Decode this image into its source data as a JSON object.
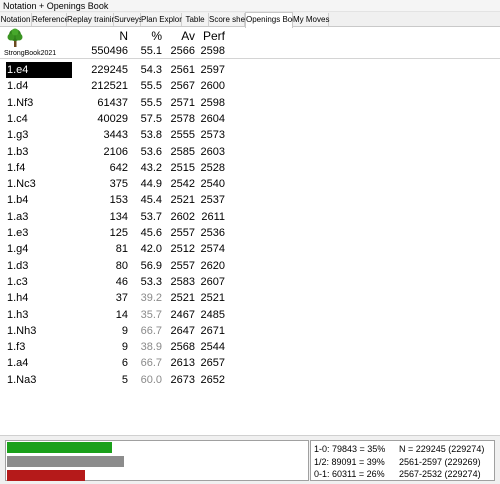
{
  "window": {
    "title": "Notation + Openings Book"
  },
  "tabs": [
    {
      "label": "Notation",
      "active": false
    },
    {
      "label": "Reference",
      "active": false
    },
    {
      "label": "Replay training",
      "active": false
    },
    {
      "label": "Surveys",
      "active": false
    },
    {
      "label": "Plan Explorer",
      "active": false
    },
    {
      "label": "Table",
      "active": false
    },
    {
      "label": "Score sheet",
      "active": false
    },
    {
      "label": "Openings Book",
      "active": true
    },
    {
      "label": "My Moves",
      "active": false
    }
  ],
  "book": {
    "name": "StrongBook2021",
    "icon": "tree-icon"
  },
  "columns": {
    "move": "",
    "n": "N",
    "pct": "%",
    "av": "Av",
    "perf": "Perf"
  },
  "totals": {
    "n": "550496",
    "pct": "55.1",
    "av": "2566",
    "perf": "2598"
  },
  "moves": [
    {
      "move": "1.e4",
      "n": "229245",
      "pct": "54.3",
      "av": "2561",
      "perf": "2597",
      "selected": true,
      "dim": false
    },
    {
      "move": "1.d4",
      "n": "212521",
      "pct": "55.5",
      "av": "2567",
      "perf": "2600",
      "selected": false,
      "dim": false
    },
    {
      "move": "1.Nf3",
      "n": "61437",
      "pct": "55.5",
      "av": "2571",
      "perf": "2598",
      "selected": false,
      "dim": false
    },
    {
      "move": "1.c4",
      "n": "40029",
      "pct": "57.5",
      "av": "2578",
      "perf": "2604",
      "selected": false,
      "dim": false
    },
    {
      "move": "1.g3",
      "n": "3443",
      "pct": "53.8",
      "av": "2555",
      "perf": "2573",
      "selected": false,
      "dim": false
    },
    {
      "move": "1.b3",
      "n": "2106",
      "pct": "53.6",
      "av": "2585",
      "perf": "2603",
      "selected": false,
      "dim": false
    },
    {
      "move": "1.f4",
      "n": "642",
      "pct": "43.2",
      "av": "2515",
      "perf": "2528",
      "selected": false,
      "dim": false
    },
    {
      "move": "1.Nc3",
      "n": "375",
      "pct": "44.9",
      "av": "2542",
      "perf": "2540",
      "selected": false,
      "dim": false
    },
    {
      "move": "1.b4",
      "n": "153",
      "pct": "45.4",
      "av": "2521",
      "perf": "2537",
      "selected": false,
      "dim": false
    },
    {
      "move": "1.a3",
      "n": "134",
      "pct": "53.7",
      "av": "2602",
      "perf": "2611",
      "selected": false,
      "dim": false
    },
    {
      "move": "1.e3",
      "n": "125",
      "pct": "45.6",
      "av": "2557",
      "perf": "2536",
      "selected": false,
      "dim": false
    },
    {
      "move": "1.g4",
      "n": "81",
      "pct": "42.0",
      "av": "2512",
      "perf": "2574",
      "selected": false,
      "dim": false
    },
    {
      "move": "1.d3",
      "n": "80",
      "pct": "56.9",
      "av": "2557",
      "perf": "2620",
      "selected": false,
      "dim": false
    },
    {
      "move": "1.c3",
      "n": "46",
      "pct": "53.3",
      "av": "2583",
      "perf": "2607",
      "selected": false,
      "dim": false
    },
    {
      "move": "1.h4",
      "n": "37",
      "pct": "39.2",
      "av": "2521",
      "perf": "2521",
      "selected": false,
      "dim": true
    },
    {
      "move": "1.h3",
      "n": "14",
      "pct": "35.7",
      "av": "2467",
      "perf": "2485",
      "selected": false,
      "dim": true
    },
    {
      "move": "1.Nh3",
      "n": "9",
      "pct": "66.7",
      "av": "2647",
      "perf": "2671",
      "selected": false,
      "dim": true
    },
    {
      "move": "1.f3",
      "n": "9",
      "pct": "38.9",
      "av": "2568",
      "perf": "2544",
      "selected": false,
      "dim": true
    },
    {
      "move": "1.a4",
      "n": "6",
      "pct": "66.7",
      "av": "2613",
      "perf": "2657",
      "selected": false,
      "dim": true
    },
    {
      "move": "1.Na3",
      "n": "5",
      "pct": "60.0",
      "av": "2673",
      "perf": "2652",
      "selected": false,
      "dim": true
    }
  ],
  "results": {
    "bars": [
      {
        "name": "white-wins",
        "fraction": 0.35,
        "color": "#1aa01a"
      },
      {
        "name": "draws",
        "fraction": 0.39,
        "color": "#8c8c8c"
      },
      {
        "name": "black-wins",
        "fraction": 0.26,
        "color": "#b51a1a"
      }
    ],
    "stats": [
      {
        "label": "1-0: 79843 = 35%",
        "detail": "N = 229245 (229274)"
      },
      {
        "label": "1/2: 89091 = 39%",
        "detail": "2561-2597 (229269)"
      },
      {
        "label": "0-1: 60311 = 26%",
        "detail": "2567-2532 (229274)"
      }
    ]
  }
}
